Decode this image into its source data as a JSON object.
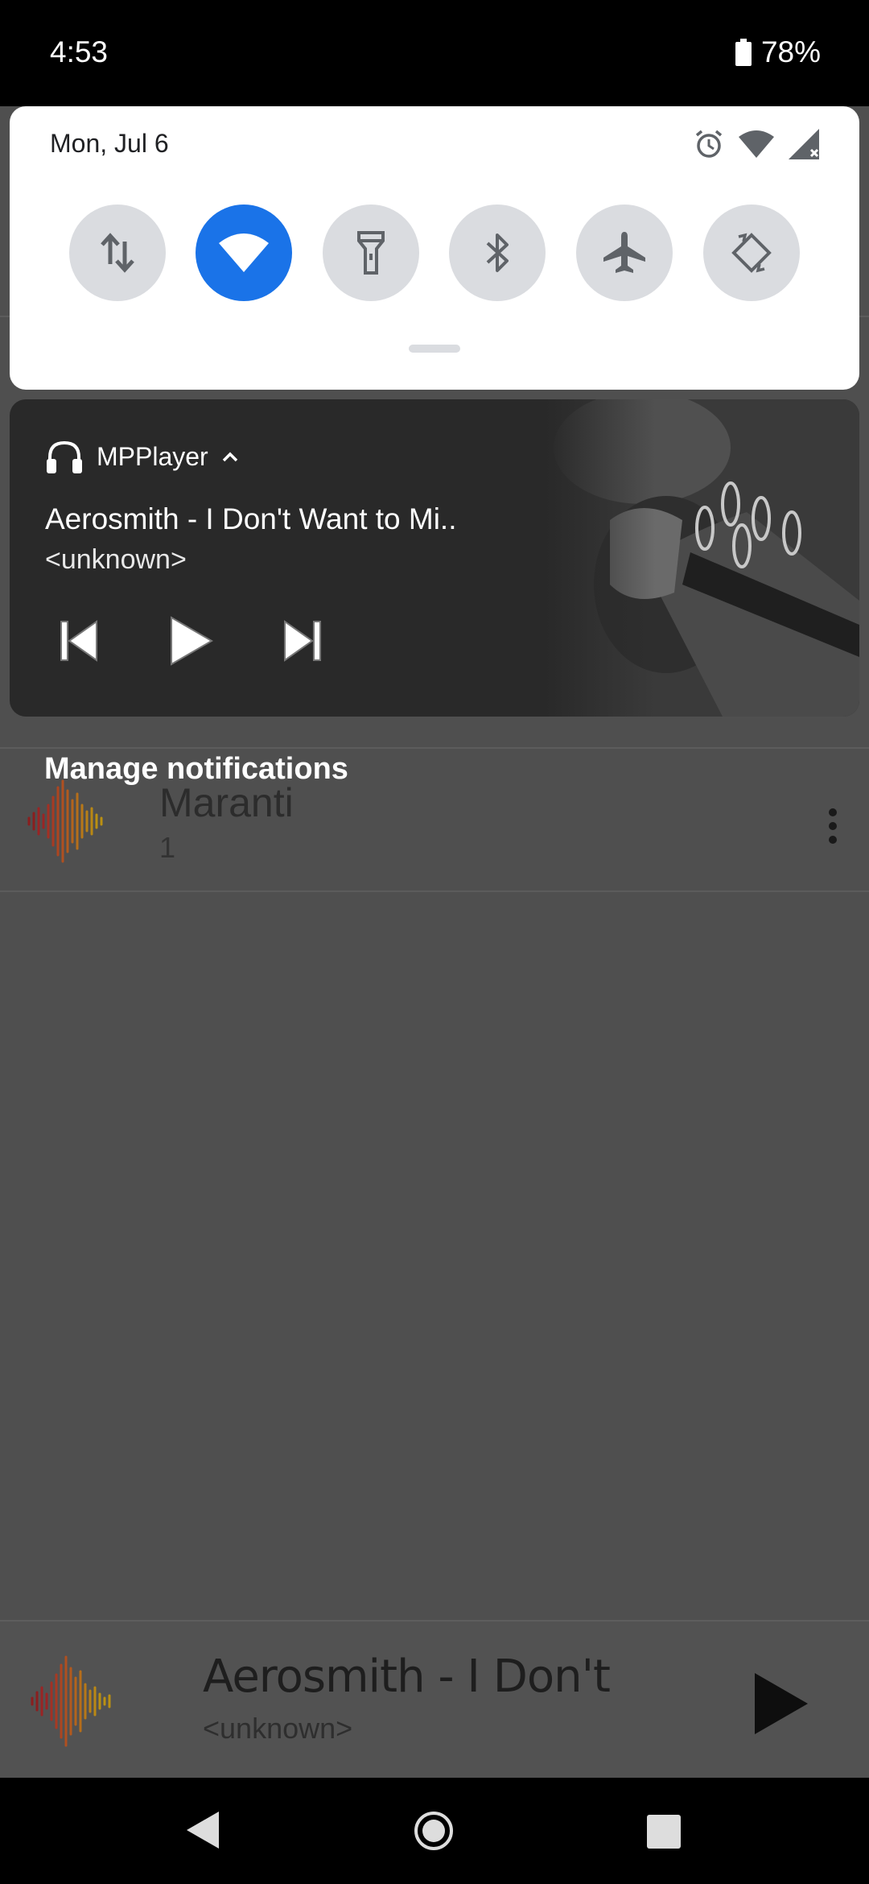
{
  "status_bar": {
    "time": "4:53",
    "battery": "78%"
  },
  "quick_settings": {
    "date": "Mon, Jul 6",
    "tiles": [
      {
        "name": "mobile-data",
        "icon": "up-down-arrows-icon",
        "active": false
      },
      {
        "name": "wifi",
        "icon": "wifi-icon",
        "active": true
      },
      {
        "name": "flashlight",
        "icon": "flashlight-icon",
        "active": false
      },
      {
        "name": "bluetooth",
        "icon": "bluetooth-icon",
        "active": false
      },
      {
        "name": "airplane-mode",
        "icon": "airplane-icon",
        "active": false
      },
      {
        "name": "auto-rotate",
        "icon": "rotate-icon",
        "active": false
      }
    ],
    "accent_color": "#1a73e8"
  },
  "media_notification": {
    "app_name": "MPPlayer",
    "title": "Aerosmith - I Don't Want to Mi..",
    "artist": "<unknown>"
  },
  "manage_notifications": "Manage notifications",
  "app_list": {
    "row_title": "Maranti",
    "row_subtitle": "1"
  },
  "mini_player": {
    "title": "Aerosmith - I Don't",
    "artist": "<unknown>"
  }
}
